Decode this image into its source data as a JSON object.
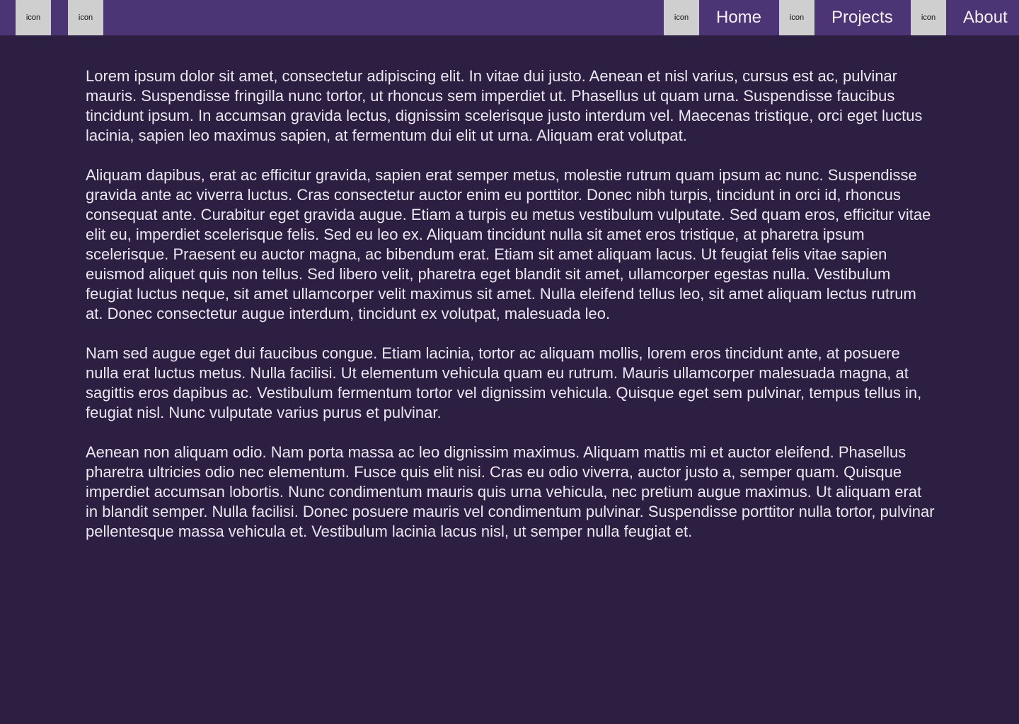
{
  "header": {
    "left_icons": [
      "icon",
      "icon"
    ],
    "nav": [
      {
        "icon": "icon",
        "label": "Home"
      },
      {
        "icon": "icon",
        "label": "Projects"
      },
      {
        "icon": "icon",
        "label": "About"
      }
    ]
  },
  "main": {
    "paragraphs": [
      "Lorem ipsum dolor sit amet, consectetur adipiscing elit. In vitae dui justo. Aenean et nisl varius, cursus est ac, pulvinar mauris. Suspendisse fringilla nunc tortor, ut rhoncus sem imperdiet ut. Phasellus ut quam urna. Suspendisse faucibus tincidunt ipsum. In accumsan gravida lectus, dignissim scelerisque justo interdum vel. Maecenas tristique, orci eget luctus lacinia, sapien leo maximus sapien, at fermentum dui elit ut urna. Aliquam erat volutpat.",
      "Aliquam dapibus, erat ac efficitur gravida, sapien erat semper metus, molestie rutrum quam ipsum ac nunc. Suspendisse gravida ante ac viverra luctus. Cras consectetur auctor enim eu porttitor. Donec nibh turpis, tincidunt in orci id, rhoncus consequat ante. Curabitur eget gravida augue. Etiam a turpis eu metus vestibulum vulputate. Sed quam eros, efficitur vitae elit eu, imperdiet scelerisque felis. Sed eu leo ex. Aliquam tincidunt nulla sit amet eros tristique, at pharetra ipsum scelerisque. Praesent eu auctor magna, ac bibendum erat. Etiam sit amet aliquam lacus. Ut feugiat felis vitae sapien euismod aliquet quis non tellus. Sed libero velit, pharetra eget blandit sit amet, ullamcorper egestas nulla. Vestibulum feugiat luctus neque, sit amet ullamcorper velit maximus sit amet. Nulla eleifend tellus leo, sit amet aliquam lectus rutrum at. Donec consectetur augue interdum, tincidunt ex volutpat, malesuada leo.",
      "Nam sed augue eget dui faucibus congue. Etiam lacinia, tortor ac aliquam mollis, lorem eros tincidunt ante, at posuere nulla erat luctus metus. Nulla facilisi. Ut elementum vehicula quam eu rutrum. Mauris ullamcorper malesuada magna, at sagittis eros dapibus ac. Vestibulum fermentum tortor vel dignissim vehicula. Quisque eget sem pulvinar, tempus tellus in, feugiat nisl. Nunc vulputate varius purus et pulvinar.",
      "Aenean non aliquam odio. Nam porta massa ac leo dignissim maximus. Aliquam mattis mi et auctor eleifend. Phasellus pharetra ultricies odio nec elementum. Fusce quis elit nisi. Cras eu odio viverra, auctor justo a, semper quam. Quisque imperdiet accumsan lobortis. Nunc condimentum mauris quis urna vehicula, nec pretium augue maximus. Ut aliquam erat in blandit semper. Nulla facilisi. Donec posuere mauris vel condimentum pulvinar. Suspendisse porttitor nulla tortor, pulvinar pellentesque massa vehicula et. Vestibulum lacinia lacus nisl, ut semper nulla feugiat et."
    ]
  },
  "colors": {
    "header_bg": "#4b3575",
    "page_bg": "#2c1f42",
    "icon_placeholder_bg": "#cfcfcf",
    "text": "#ebe8f0"
  }
}
